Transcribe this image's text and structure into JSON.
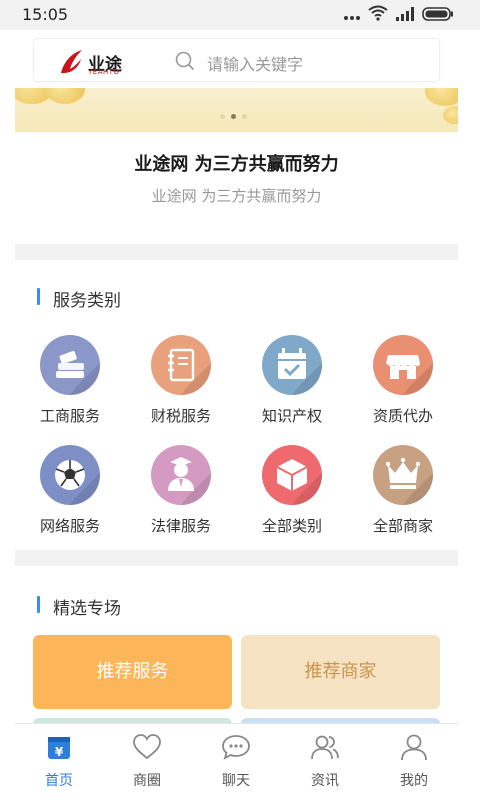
{
  "status_bar": {
    "time": "15:05"
  },
  "search": {
    "logo_text": "业途",
    "logo_sub": "YEAHTO",
    "placeholder": "请输入关键字"
  },
  "banner": {
    "dots": 3,
    "active_dot": 1
  },
  "headline": {
    "title": "业途网 为三方共赢而努力",
    "subtitle": "业途网 为三方共赢而努力"
  },
  "services": {
    "title": "服务类别",
    "items": [
      {
        "label": "工商服务",
        "icon": "books-icon",
        "color": "#8b96c9"
      },
      {
        "label": "财税服务",
        "icon": "notebook-icon",
        "color": "#e9a07c"
      },
      {
        "label": "知识产权",
        "icon": "calendar-check-icon",
        "color": "#7fa8c9"
      },
      {
        "label": "资质代办",
        "icon": "store-icon",
        "color": "#e98f72"
      },
      {
        "label": "网络服务",
        "icon": "soccer-ball-icon",
        "color": "#7e8fc6"
      },
      {
        "label": "法律服务",
        "icon": "lawyer-icon",
        "color": "#d49ac2"
      },
      {
        "label": "全部类别",
        "icon": "cube-icon",
        "color": "#ee6a6e"
      },
      {
        "label": "全部商家",
        "icon": "crown-icon",
        "color": "#c8a183"
      }
    ]
  },
  "featured": {
    "title": "精选专场",
    "cards": [
      {
        "label": "推荐服务",
        "bg": "#fdb55a",
        "fg": "#ffffff"
      },
      {
        "label": "推荐商家",
        "bg": "#f6e3c4",
        "fg": "#c9944f"
      }
    ]
  },
  "tabbar": {
    "items": [
      {
        "label": "首页",
        "icon": "home-wallet-icon",
        "active": true
      },
      {
        "label": "商圈",
        "icon": "heart-icon",
        "active": false
      },
      {
        "label": "聊天",
        "icon": "chat-icon",
        "active": false
      },
      {
        "label": "资讯",
        "icon": "users-icon",
        "active": false
      },
      {
        "label": "我的",
        "icon": "user-icon",
        "active": false
      }
    ]
  }
}
